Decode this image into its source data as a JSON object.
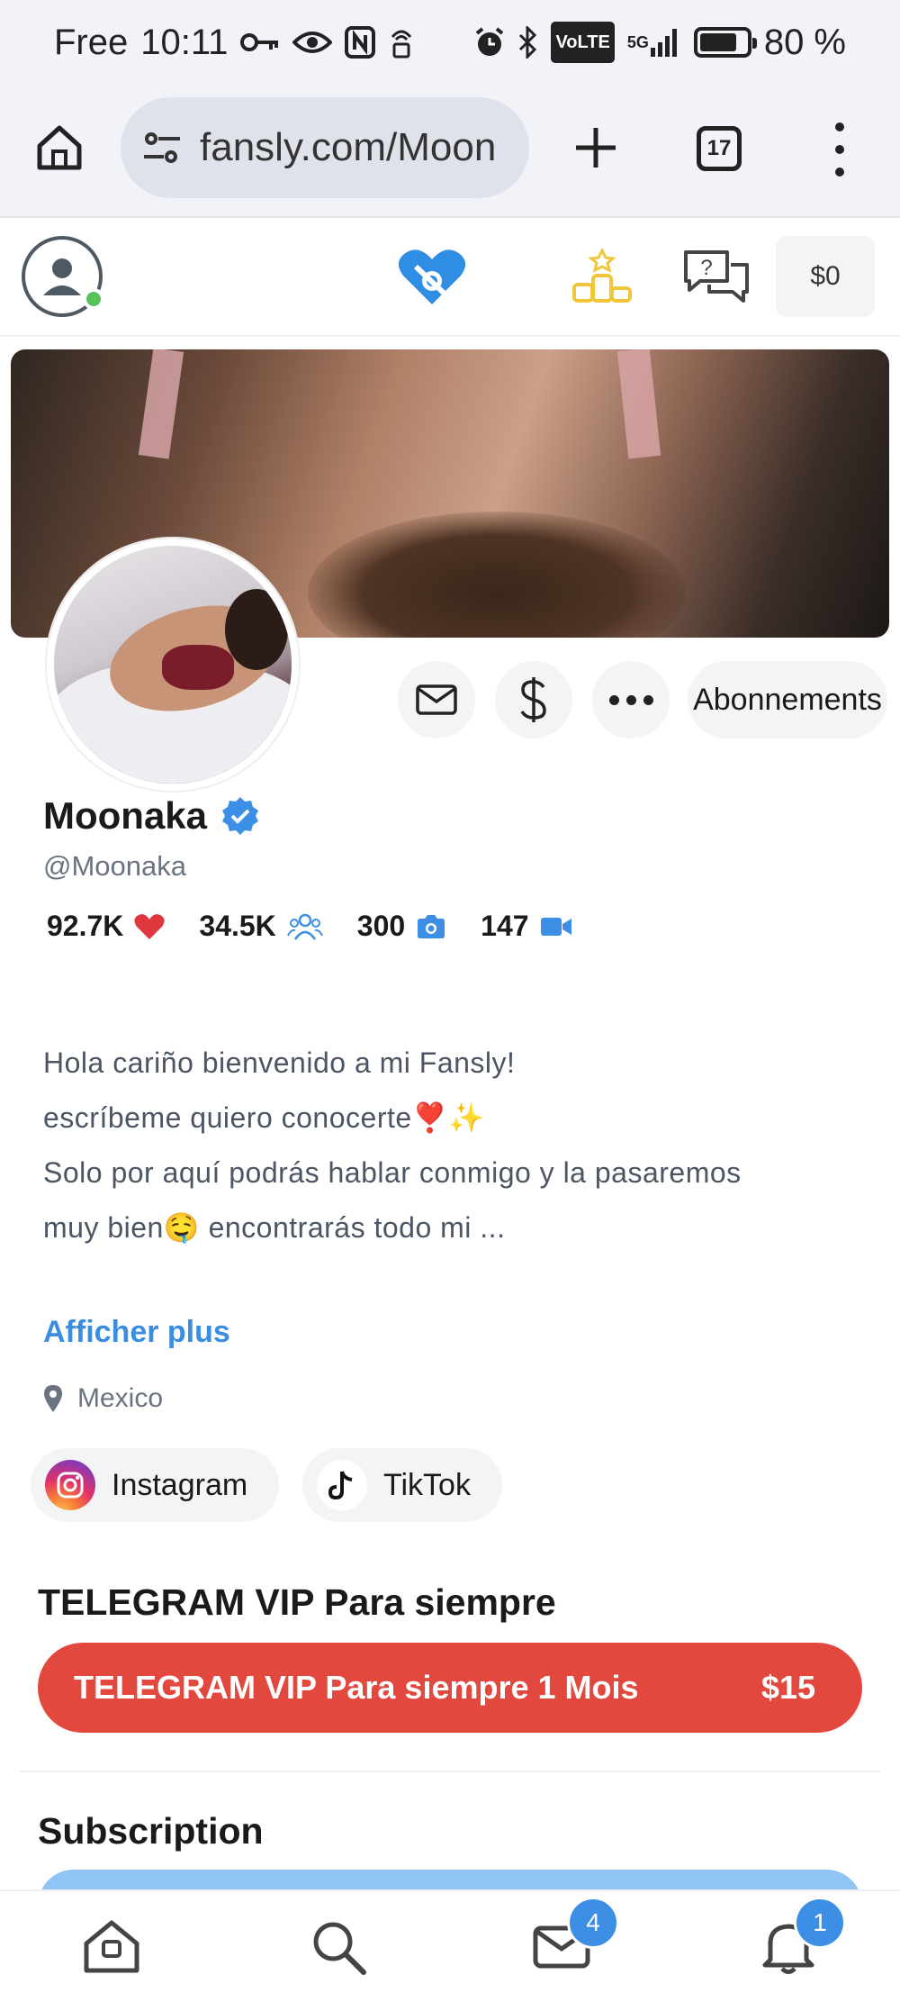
{
  "status_bar": {
    "time_prefix": "Free",
    "time": "10:11",
    "volte": "VoLTE",
    "network": "5G",
    "battery_percent_label": "80 %",
    "battery_level": 0.8
  },
  "browser": {
    "url": "fansly.com/Moon",
    "tab_count": "17"
  },
  "header": {
    "wallet_balance": "$0"
  },
  "profile": {
    "name": "Moonaka",
    "handle": "@Moonaka",
    "verified": true,
    "stats": {
      "likes": "92.7K",
      "followers": "34.5K",
      "photos": "300",
      "videos": "147"
    },
    "actions": {
      "subscriptions_label": "Abonnements"
    },
    "bio_lines": [
      "Hola cariño bienvenido a mi Fansly!",
      "escríbeme quiero conocerte❣️✨",
      "",
      "Solo por aquí podrás hablar conmigo y la pasaremos",
      "muy bien🤤 encontrarás todo mi ..."
    ],
    "show_more_label": "Afficher plus",
    "location": "Mexico",
    "socials": [
      {
        "label": "Instagram",
        "icon": "instagram-icon"
      },
      {
        "label": "TikTok",
        "icon": "tiktok-icon"
      }
    ]
  },
  "tiers": {
    "section_title": "TELEGRAM VIP Para siempre",
    "button_label": "TELEGRAM VIP Para siempre 1 Mois",
    "price": "$15"
  },
  "subscription": {
    "section_title": "Subscription"
  },
  "bottom_nav": {
    "messages_badge": "4",
    "notifications_badge": "1"
  },
  "colors": {
    "accent_blue": "#3b8de0",
    "tier_red": "#e3483f",
    "online_green": "#58c25a",
    "heart_red": "#e0363d"
  }
}
